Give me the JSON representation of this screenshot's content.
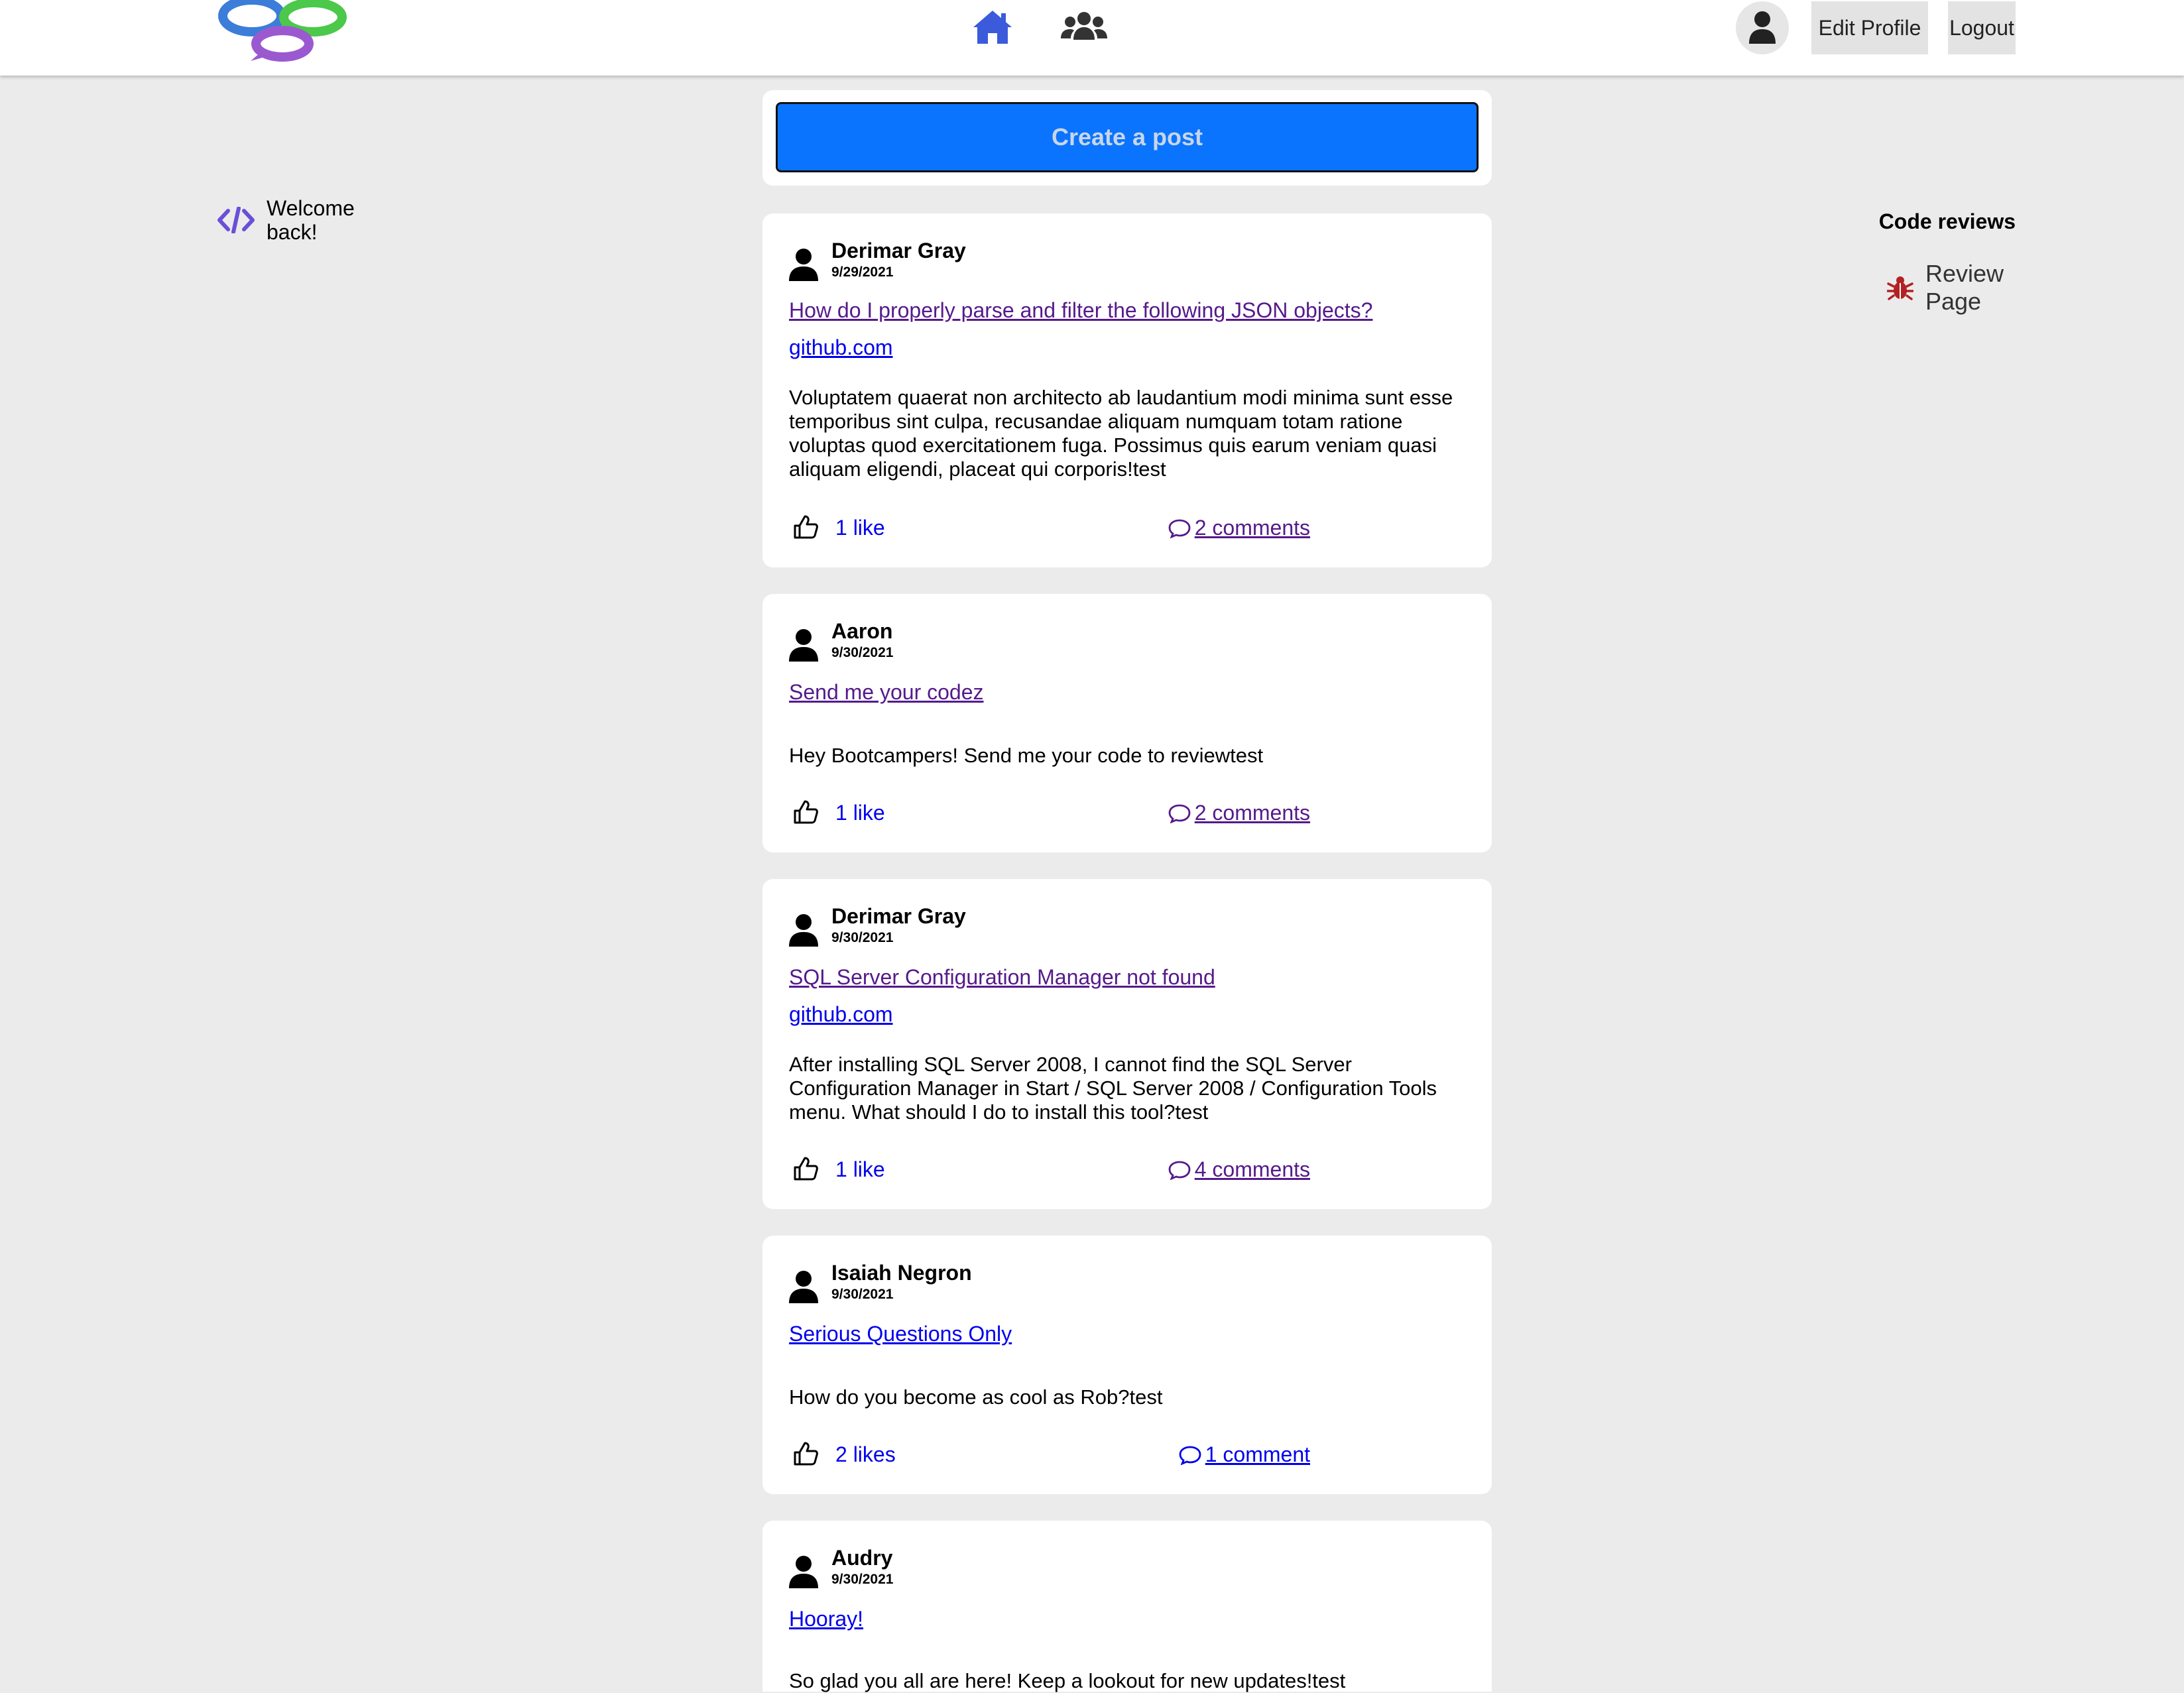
{
  "header": {
    "logo_name": "chat-bubbles-logo",
    "nav": [
      "home-icon",
      "users-icon"
    ],
    "edit_profile": "Edit Profile",
    "logout": "Logout"
  },
  "sidebar_left": {
    "welcome": "Welcome back!"
  },
  "sidebar_right": {
    "title": "Code reviews",
    "review_link": "Review Page"
  },
  "main": {
    "create_post": "Create a post",
    "posts": [
      {
        "author": "Derimar Gray",
        "date": "9/29/2021",
        "title": "How do I properly parse and filter the following JSON objects?",
        "link": "github.com",
        "body": "Voluptatem quaerat non architecto ab laudantium modi minima sunt esse temporibus sint culpa, recusandae aliquam numquam totam ratione voluptas quod exercitationem fuga. Possimus quis earum veniam quasi aliquam eligendi, placeat qui corporis!test",
        "likes": "1 like",
        "comments": "2 comments"
      },
      {
        "author": "Aaron",
        "date": "9/30/2021",
        "title": "Send me your codez",
        "link": "",
        "body": "Hey Bootcampers! Send me your code to reviewtest",
        "likes": "1 like",
        "comments": "2 comments"
      },
      {
        "author": "Derimar Gray",
        "date": "9/30/2021",
        "title": "SQL Server Configuration Manager not found",
        "link": "github.com",
        "body": "After installing SQL Server 2008, I cannot find the SQL Server Configuration Manager in Start / SQL Server 2008 / Configuration Tools menu. What should I do to install this tool?test",
        "likes": "1 like",
        "comments": "4 comments"
      },
      {
        "author": "Isaiah Negron",
        "date": "9/30/2021",
        "title": "Serious Questions Only",
        "link": "",
        "body": "How do you become as cool as Rob?test",
        "likes": "2 likes",
        "comments": "1 comment"
      },
      {
        "author": "Audry",
        "date": "9/30/2021",
        "title": "Hooray!",
        "link": "",
        "body": "So glad you all are here! Keep a lookout for new updates!test",
        "likes": "",
        "comments": ""
      }
    ]
  },
  "colors": {
    "background": "#ebebeb",
    "primary_button": "#0a74ff",
    "visited_link": "#551a8b",
    "link": "#0000ee",
    "accent_icon": "#3b5bdb",
    "code_icon": "#6a4fd8",
    "bug_icon": "#b22222"
  }
}
